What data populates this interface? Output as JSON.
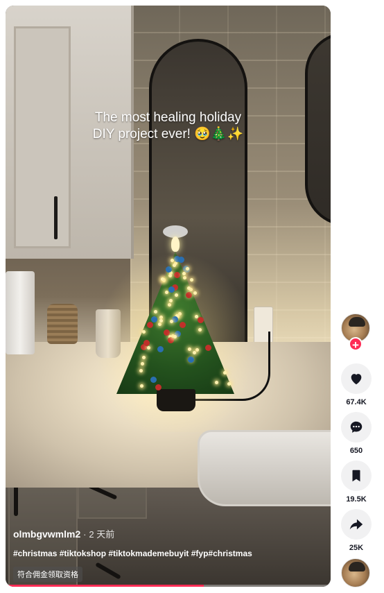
{
  "video": {
    "caption_line1": "The most healing holiday",
    "caption_line2": "DIY project ever! 🥹🎄✨",
    "username": "olmbgvwmlm2",
    "separator": "·",
    "posted": "2 天前",
    "hashtags": "#christmas #tiktokshop #tiktokmademebuyit #fyp#christmas",
    "badge": "符合佣金领取资格",
    "progress_fraction": 0.61
  },
  "actions": {
    "like_count": "67.4K",
    "comment_count": "650",
    "save_count": "19.5K",
    "share_count": "25K",
    "follow_symbol": "+"
  },
  "colors": {
    "accent": "#fe2c55",
    "rail_button": "#f1f1f2",
    "text_dark": "#161823"
  }
}
